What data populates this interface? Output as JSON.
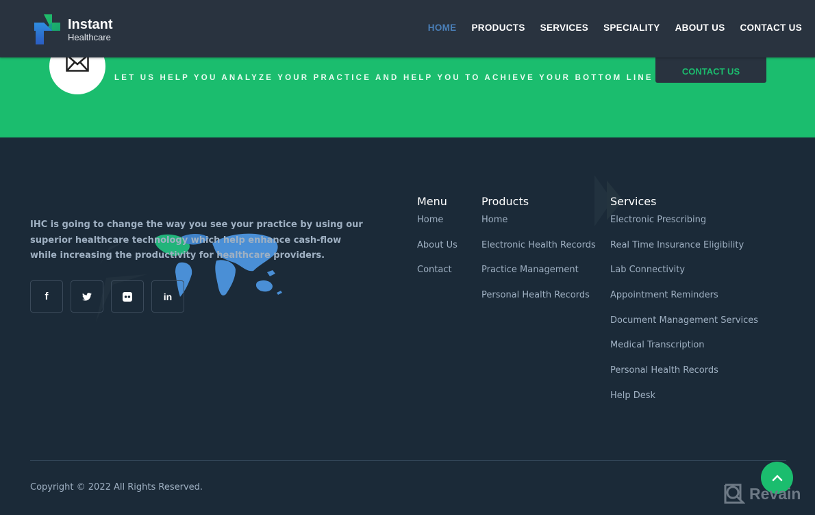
{
  "header": {
    "logo": {
      "title": "Instant",
      "subtitle": "Healthcare"
    },
    "nav": [
      {
        "label": "HOME",
        "active": true
      },
      {
        "label": "PRODUCTS",
        "active": false
      },
      {
        "label": "SERVICES",
        "active": false
      },
      {
        "label": "SPECIALITY",
        "active": false
      },
      {
        "label": "ABOUT US",
        "active": false
      },
      {
        "label": "CONTACT US",
        "active": false
      }
    ]
  },
  "cta": {
    "icon": "envelope-icon",
    "text": "LET US HELP YOU ANALYZE YOUR PRACTICE AND HELP YOU TO ACHIEVE YOUR BOTTOM LINE",
    "button_label": "CONTACT US"
  },
  "footer": {
    "about": "IHC is going to change the way you see your practice by using our superior healthcare technology which help enhance cash-flow while increasing the productivity for healthcare providers.",
    "social": [
      {
        "name": "facebook",
        "glyph": "f"
      },
      {
        "name": "twitter",
        "glyph": ""
      },
      {
        "name": "flickr",
        "glyph": ""
      },
      {
        "name": "linkedin",
        "glyph": "in"
      }
    ],
    "menu": {
      "title": "Menu",
      "items": [
        "Home",
        "About Us",
        "Contact"
      ]
    },
    "products": {
      "title": "Products",
      "items": [
        "Home",
        "Electronic Health Records",
        "Practice Management",
        "Personal Health Records"
      ]
    },
    "services": {
      "title": "Services",
      "items": [
        "Electronic Prescribing",
        "Real Time Insurance Eligibility",
        "Lab Connectivity",
        "Appointment Reminders",
        "Document Management Services",
        "Medical Transcription",
        "Personal Health Records",
        "Help Desk"
      ]
    },
    "copyright": "Copyright © 2022 All Rights Reserved.",
    "revain": "Revain"
  },
  "colors": {
    "header_bg": "#29333f",
    "accent_green": "#1bbd6e",
    "footer_bg": "#1b2a38",
    "nav_active": "#4a7fb8",
    "link_text": "#9fb0c2"
  }
}
